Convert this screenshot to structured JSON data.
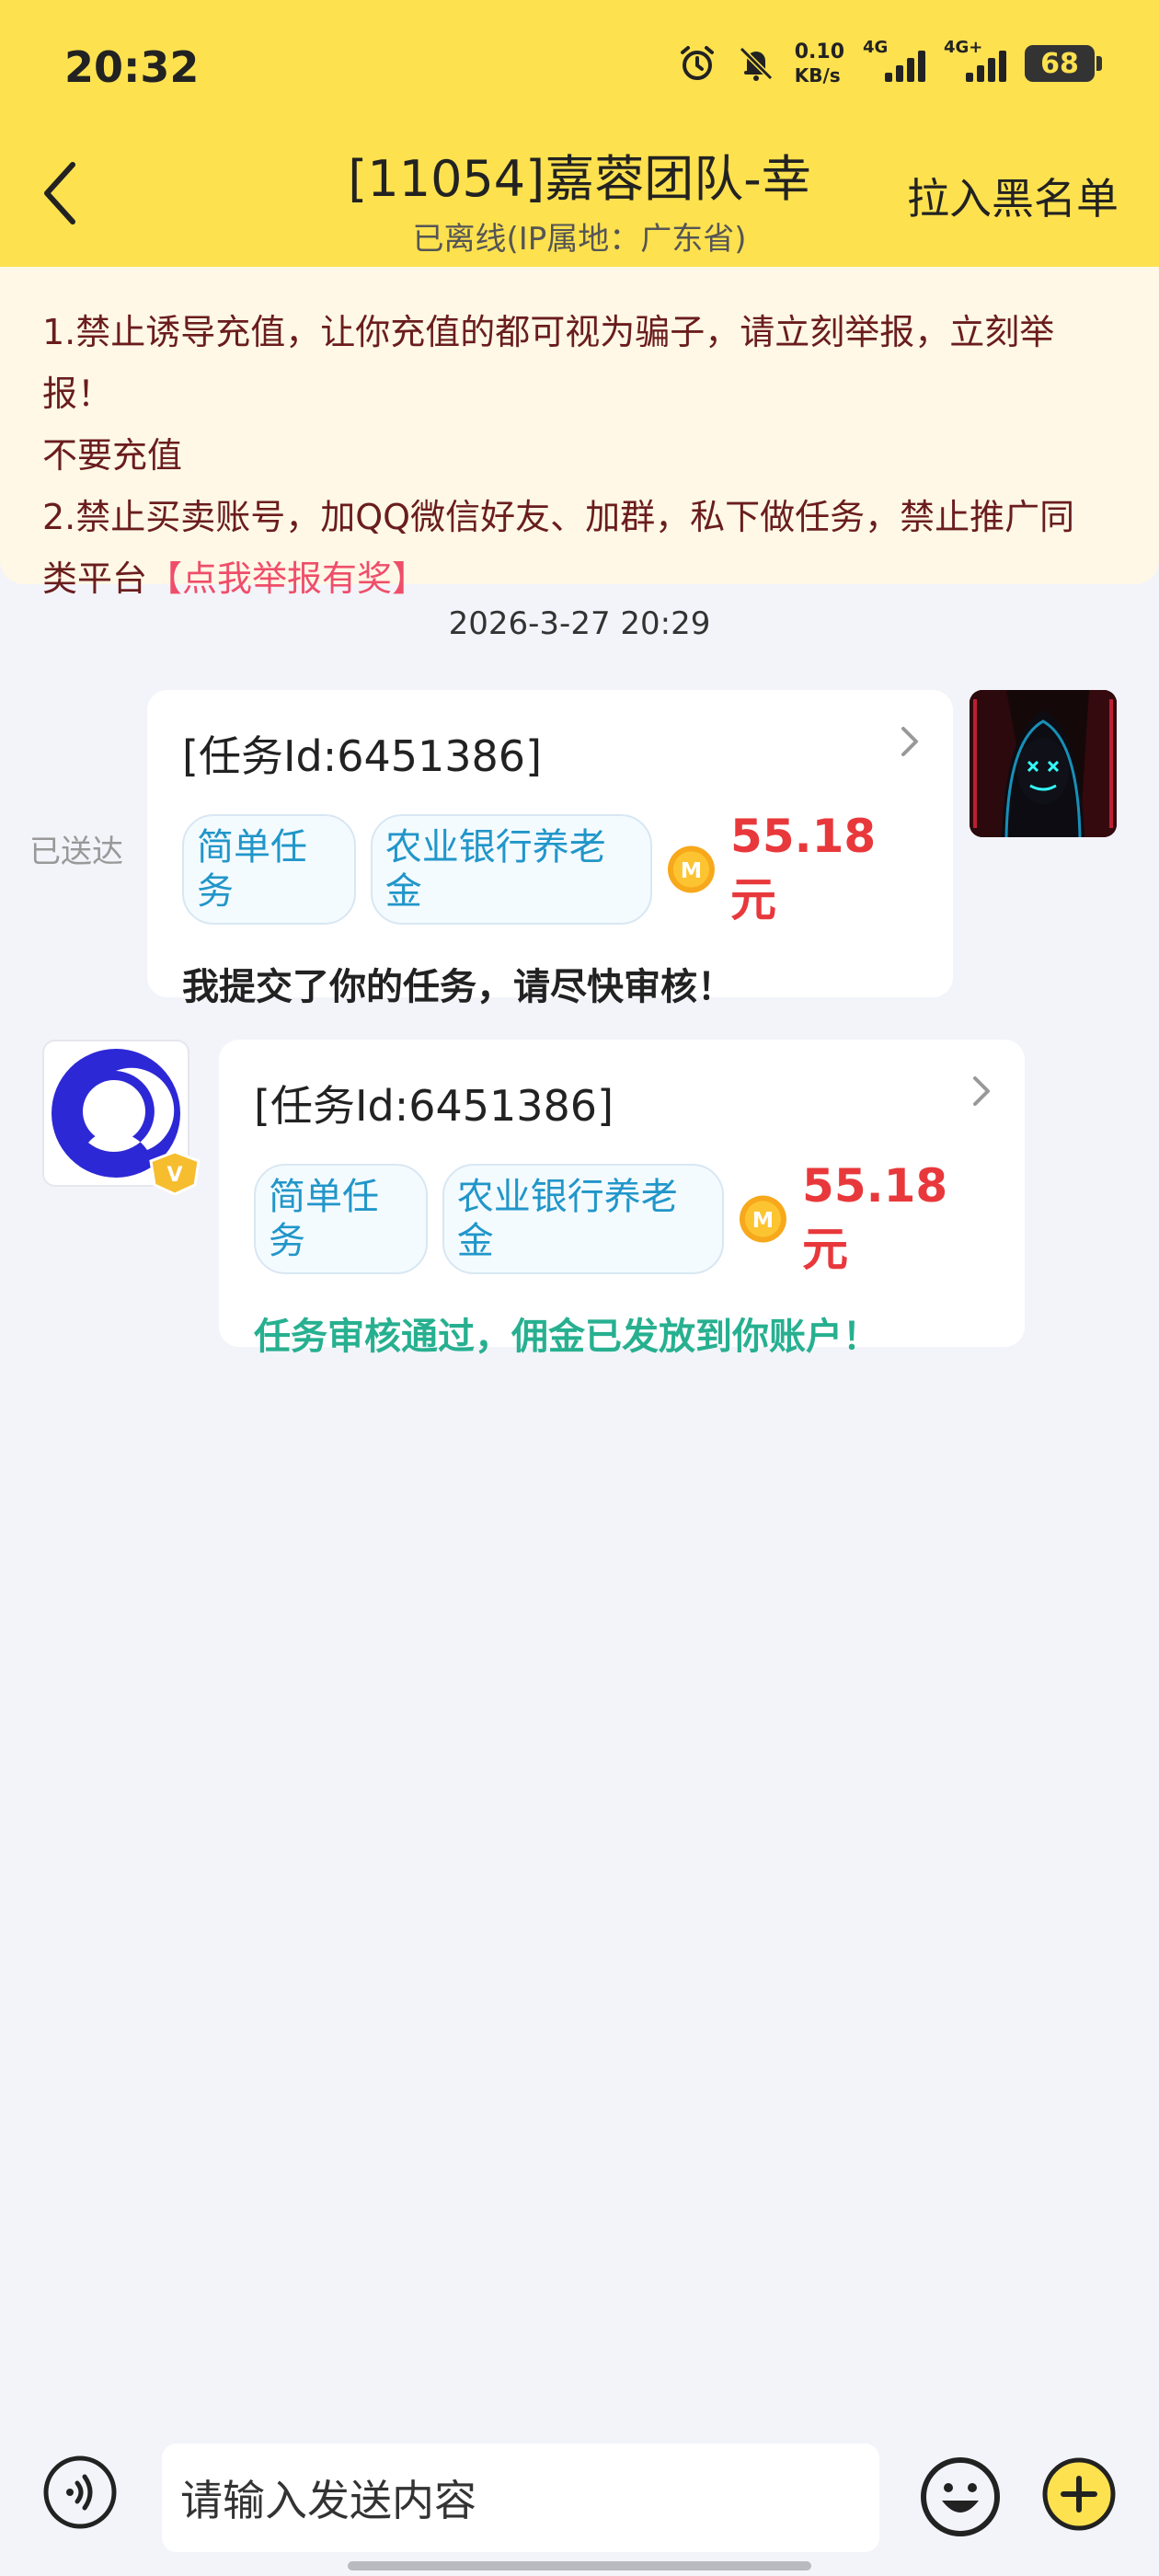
{
  "status": {
    "time": "20:32",
    "net_speed": "0.10",
    "net_unit": "KB/s",
    "signal1": "4G",
    "signal2": "4G+",
    "battery": "68"
  },
  "header": {
    "title": "[11054]嘉蓉团队-幸",
    "subtitle": "已离线(IP属地：广东省)",
    "blacklist": "拉入黑名单"
  },
  "notice": {
    "line1": "1.禁止诱导充值，让你充值的都可视为骗子，请立刻举报，立刻举报！",
    "line2": "不要充值",
    "line3": "2.禁止买卖账号，加QQ微信好友、加群，私下做任务，禁止推广同",
    "line4_prefix": "类平台",
    "line4_link": "【点我举报有奖】"
  },
  "timestamp": "2026-3-27 20:29",
  "messages": [
    {
      "status": "已送达",
      "task_id": "[任务Id:6451386]",
      "tag1": "简单任务",
      "tag2": "农业银行养老金",
      "price": "55.18元",
      "text": "我提交了你的任务，请尽快审核！"
    },
    {
      "task_id": "[任务Id:6451386]",
      "tag1": "简单任务",
      "tag2": "农业银行养老金",
      "price": "55.18元",
      "text": "任务审核通过，佣金已发放到你账户！"
    }
  ],
  "input": {
    "placeholder": "请输入发送内容"
  },
  "colors": {
    "header_bg": "#fde14f",
    "price": "#e8383b",
    "success": "#27b090",
    "link": "#ef4e6a"
  }
}
